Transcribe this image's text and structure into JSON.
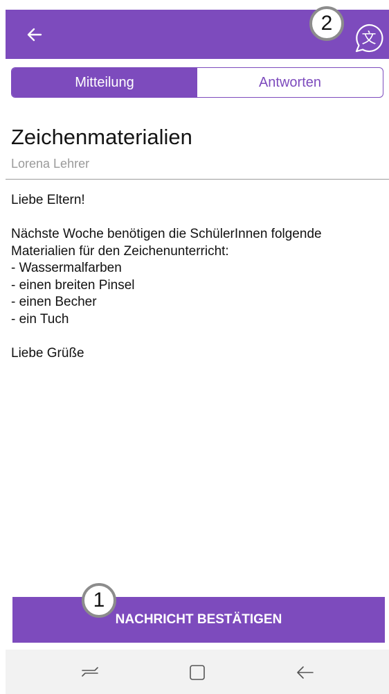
{
  "header": {
    "back_icon": "arrow-left-icon",
    "translate_icon": "translate-icon"
  },
  "callouts": {
    "one": "1",
    "two": "2"
  },
  "tabs": [
    {
      "label": "Mitteilung",
      "active": true
    },
    {
      "label": "Antworten",
      "active": false
    }
  ],
  "message": {
    "title": "Zeichenmaterialien",
    "author": "Lorena Lehrer",
    "lines": [
      "Liebe Eltern!",
      "",
      "Nächste Woche benötigen die SchülerInnen folgende",
      "Materialien für den Zeichenunterricht:",
      "- Wassermalfarben",
      "- einen breiten Pinsel",
      "- einen Becher",
      "- ein Tuch",
      "",
      "Liebe Grüße"
    ]
  },
  "confirm_button": {
    "label": "NACHRICHT BESTÄTIGEN"
  },
  "navbar": {
    "items": [
      "recent-apps-icon",
      "home-icon",
      "back-icon"
    ]
  },
  "colors": {
    "primary": "#7d4bbd",
    "navbar": "#f2f2f2",
    "divider": "#9c9c9c",
    "secondary_text": "#9a9a9a"
  }
}
